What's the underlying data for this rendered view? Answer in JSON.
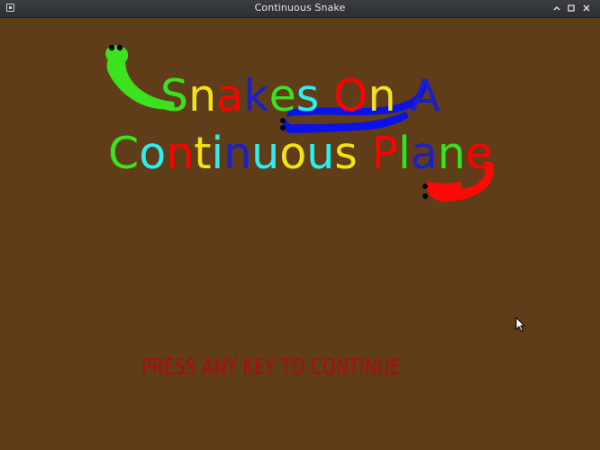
{
  "window": {
    "title": "Continuous Snake",
    "icons": [
      "app-icon",
      "minimize-icon",
      "maximize-icon",
      "close-icon"
    ]
  },
  "title_screen": {
    "line1": {
      "text": "Snakes On A",
      "letters": [
        {
          "ch": "S",
          "color": "#3de21f"
        },
        {
          "ch": "n",
          "color": "#f4e312"
        },
        {
          "ch": "a",
          "color": "#ff0000"
        },
        {
          "ch": "k",
          "color": "#1e1ec8"
        },
        {
          "ch": "e",
          "color": "#3de21f"
        },
        {
          "ch": "s",
          "color": "#2cf0f0"
        },
        {
          "ch": " ",
          "color": "#3de21f"
        },
        {
          "ch": "O",
          "color": "#ff0000"
        },
        {
          "ch": "n",
          "color": "#f4e312"
        },
        {
          "ch": " ",
          "color": "#3de21f"
        },
        {
          "ch": "A",
          "color": "#1e1ec8"
        }
      ]
    },
    "line2": {
      "text": "Continuous Plane",
      "letters": [
        {
          "ch": "C",
          "color": "#3de21f"
        },
        {
          "ch": "o",
          "color": "#2cf0f0"
        },
        {
          "ch": "n",
          "color": "#ff0000"
        },
        {
          "ch": "t",
          "color": "#f4e312"
        },
        {
          "ch": "i",
          "color": "#2cf0f0"
        },
        {
          "ch": "n",
          "color": "#1e1ec8"
        },
        {
          "ch": "u",
          "color": "#2cf0f0"
        },
        {
          "ch": "o",
          "color": "#f4e312"
        },
        {
          "ch": "u",
          "color": "#2cf0f0"
        },
        {
          "ch": "s",
          "color": "#f4e312"
        },
        {
          "ch": " ",
          "color": "#3de21f"
        },
        {
          "ch": "P",
          "color": "#ff0000"
        },
        {
          "ch": "l",
          "color": "#3de21f"
        },
        {
          "ch": "a",
          "color": "#1e1ec8"
        },
        {
          "ch": "n",
          "color": "#3de21f"
        },
        {
          "ch": "e",
          "color": "#ff0000"
        }
      ]
    },
    "snakes": [
      {
        "name": "green-snake",
        "color": "#3de21f"
      },
      {
        "name": "blue-snake",
        "color": "#0a12e6"
      },
      {
        "name": "red-snake",
        "color": "#ff0808"
      }
    ],
    "prompt": "PRESS ANY KEY TO CONTINUE",
    "prompt_color": "#b20a0a",
    "background_color": "#5f3d18"
  }
}
